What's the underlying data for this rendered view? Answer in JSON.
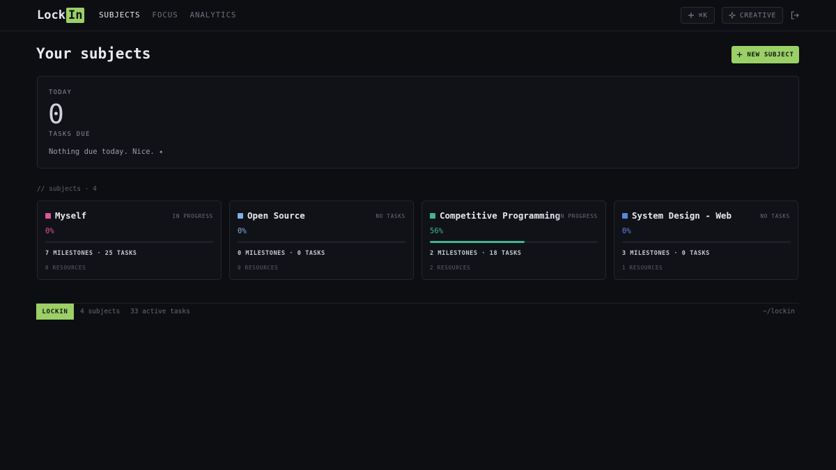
{
  "logo": {
    "prefix": "Lock",
    "highlight": "In"
  },
  "nav": [
    "SUBJECTS",
    "FOCUS",
    "ANALYTICS"
  ],
  "actions": {
    "shortcut": "⌘K",
    "mode": "CREATIVE"
  },
  "header": {
    "title": "Your subjects",
    "new_button": "NEW SUBJECT"
  },
  "today": {
    "label": "TODAY",
    "count": "0",
    "sublabel": "TASKS DUE",
    "message": "Nothing due today. Nice. ✦"
  },
  "section_label": "// subjects · 4",
  "subjects": [
    {
      "name": "Myself",
      "status": "IN PROGRESS",
      "percent": "0%",
      "progress": 0,
      "color": "#e0559a",
      "meta": "7 MILESTONES · 25 TASKS",
      "resources": "0 RESOURCES"
    },
    {
      "name": "Open Source",
      "status": "NO TASKS",
      "percent": "0%",
      "progress": 0,
      "color": "#7fb0e6",
      "meta": "0 MILESTONES · 0 TASKS",
      "resources": "0 RESOURCES"
    },
    {
      "name": "Competitive Programming",
      "status": "IN PROGRESS",
      "percent": "56%",
      "progress": 0.56,
      "color": "#3fb68e",
      "meta": "2 MILESTONES · 18 TASKS",
      "resources": "2 RESOURCES"
    },
    {
      "name": "System Design - Web",
      "status": "NO TASKS",
      "percent": "0%",
      "progress": 0,
      "color": "#5b86e0",
      "meta": "3 MILESTONES · 0 TASKS",
      "resources": "1 RESOURCES"
    }
  ],
  "footer": {
    "badge": "LOCKIN",
    "subjects": "4 subjects",
    "tasks": "33 active tasks",
    "path": "~/lockin"
  },
  "colors": {
    "accent": "#9bd067",
    "background": "#0d0e12"
  }
}
